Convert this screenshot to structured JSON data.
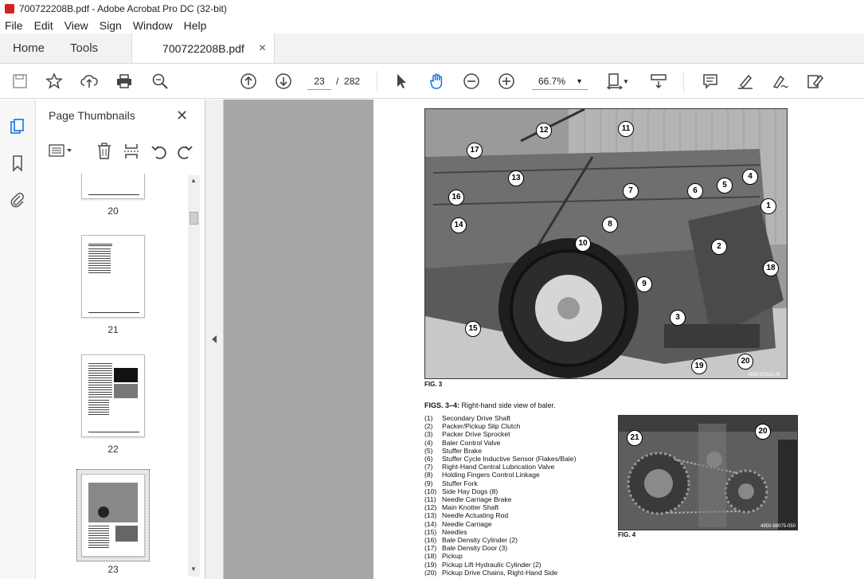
{
  "window": {
    "title": "700722208B.pdf - Adobe Acrobat Pro DC (32-bit)"
  },
  "menu": [
    "File",
    "Edit",
    "View",
    "Sign",
    "Window",
    "Help"
  ],
  "tabs": {
    "home": "Home",
    "tools": "Tools",
    "document": "700722208B.pdf",
    "close": "×"
  },
  "toolbar": {
    "page_current": "23",
    "page_sep": "/",
    "page_total": "282",
    "zoom": "66.7%"
  },
  "thumbnails": {
    "title": "Page Thumbnails",
    "close": "✕",
    "pages": [
      "20",
      "21",
      "22",
      "23"
    ],
    "selected": "23"
  },
  "document": {
    "fig3_label": "FIG. 3",
    "fig3_code": "4950-97025-26",
    "fig4_label": "FIG. 4",
    "fig4_code": "4950-98075-050",
    "caption_bold": "FIGS. 3–4:",
    "caption_text": " Right-hand side view of baler.",
    "callouts_fig3": [
      "1",
      "2",
      "3",
      "4",
      "5",
      "6",
      "7",
      "8",
      "9",
      "10",
      "11",
      "12",
      "13",
      "14",
      "15",
      "16",
      "17",
      "18",
      "19",
      "20"
    ],
    "callouts_fig4": [
      "21",
      "20"
    ],
    "legend": [
      {
        "num": "(1)",
        "text": "Secondary Drive Shaft"
      },
      {
        "num": "(2)",
        "text": "Packer/Pickup Slip Clutch"
      },
      {
        "num": "(3)",
        "text": "Packer Drive Sprocket"
      },
      {
        "num": "(4)",
        "text": "Baler Control Valve"
      },
      {
        "num": "(5)",
        "text": "Stuffer Brake"
      },
      {
        "num": "(6)",
        "text": "Stuffer Cycle Inductive Sensor (Flakes/Bale)"
      },
      {
        "num": "(7)",
        "text": "Right-Hand Central Lubrication Valve"
      },
      {
        "num": "(8)",
        "text": "Holding Fingers Control Linkage"
      },
      {
        "num": "(9)",
        "text": "Stuffer Fork"
      },
      {
        "num": "(10)",
        "text": "Side Hay Dogs (8)"
      },
      {
        "num": "(11)",
        "text": "Needle Carriage Brake"
      },
      {
        "num": "(12)",
        "text": "Main Knotter Shaft"
      },
      {
        "num": "(13)",
        "text": "Needle Actuating Rod"
      },
      {
        "num": "(14)",
        "text": "Needle Carriage"
      },
      {
        "num": "(15)",
        "text": "Needles"
      },
      {
        "num": "(16)",
        "text": "Bale Density Cylinder (2)"
      },
      {
        "num": "(17)",
        "text": "Bale Density Door (3)"
      },
      {
        "num": "(18)",
        "text": "Pickup"
      },
      {
        "num": "(19)",
        "text": "Pickup Lift Hydraulic Cylinder (2)"
      },
      {
        "num": "(20)",
        "text": "Pickup Drive Chains, Right-Hand Side"
      }
    ]
  }
}
